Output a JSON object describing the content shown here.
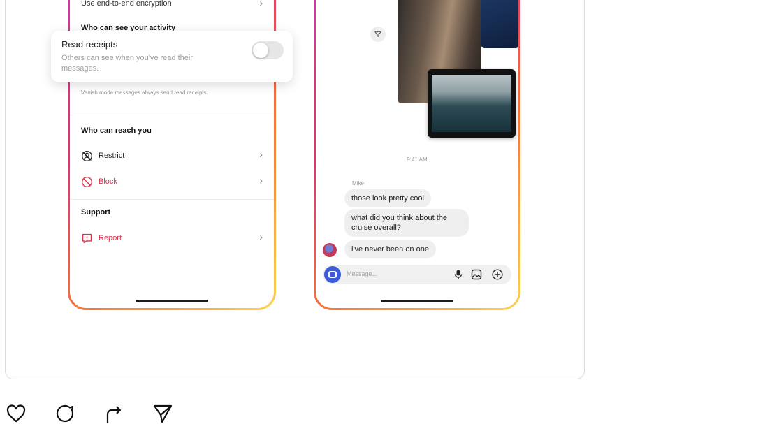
{
  "settings": {
    "e2e_row": "Use end-to-end encryption",
    "activity_section": "Who can see your activity",
    "vanish_note": "Vanish mode messages always send read receipts.",
    "reach_section": "Who can reach you",
    "restrict_label": "Restrict",
    "block_label": "Block",
    "support_section": "Support",
    "report_label": "Report"
  },
  "popup": {
    "title": "Read receipts",
    "description": "Others can see when you've read their messages.",
    "toggle_on": false
  },
  "chat": {
    "time": "9:41 AM",
    "sender": "Mike",
    "messages": [
      "those look pretty cool",
      "what did you think about the cruise overall?",
      "i've never been on one"
    ],
    "input_placeholder": "Message..."
  },
  "colors": {
    "gradient": [
      "#c837ab",
      "#e1306c",
      "#f77737",
      "#fcd34d"
    ],
    "danger": "#d6334c",
    "camera": "#3b5bdb"
  },
  "post_actions": [
    "heart-icon",
    "comment-icon",
    "share-icon",
    "send-icon"
  ]
}
